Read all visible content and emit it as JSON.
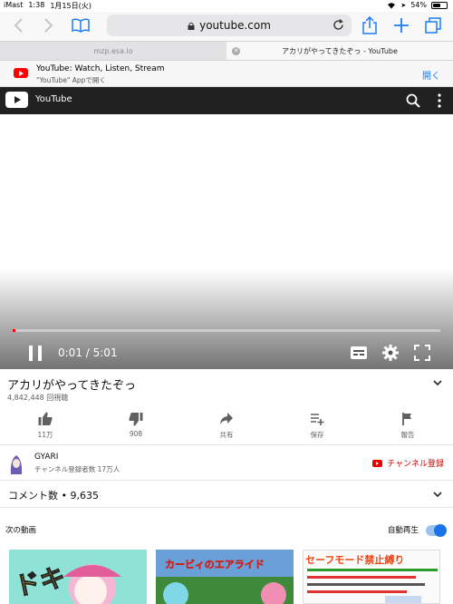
{
  "status_bar": {
    "carrier": "iMast",
    "time": "1:38",
    "date": "1月15日(火)",
    "battery": "54%",
    "battery_level": 0.54
  },
  "safari": {
    "url": "youtube.com",
    "tabs": [
      {
        "label": "mzp.esa.io",
        "active": false
      },
      {
        "label": "アカリがやってきたぞっ - YouTube",
        "active": true
      }
    ],
    "icons": [
      "back-icon",
      "forward-icon",
      "bookmarks-icon",
      "lock-icon",
      "reload-icon",
      "share-icon",
      "new-tab-icon",
      "tabs-icon"
    ]
  },
  "app_banner": {
    "title": "YouTube: Watch, Listen, Stream",
    "subtitle": "\"YouTube\" Appで開く",
    "open_label": "開く"
  },
  "yt_header": {
    "title": "YouTube"
  },
  "player": {
    "current_time": "0:01",
    "separator": " / ",
    "duration": "5:01",
    "progress": 0.003
  },
  "video": {
    "title": "アカリがやってきたぞっ",
    "views": "4,842,448 回視聴",
    "actions": [
      {
        "name": "like",
        "label": "11万",
        "icon": "thumbs-up-icon"
      },
      {
        "name": "dislike",
        "label": "908",
        "icon": "thumbs-down-icon"
      },
      {
        "name": "share",
        "label": "共有",
        "icon": "share-arrow-icon"
      },
      {
        "name": "save",
        "label": "保存",
        "icon": "playlist-add-icon"
      },
      {
        "name": "report",
        "label": "報告",
        "icon": "flag-icon"
      }
    ]
  },
  "channel": {
    "name": "GYARI",
    "subscribers": "チャンネル登録者数 17万人",
    "subscribe_label": "チャンネル登録"
  },
  "comments": {
    "label": "コメント数 • 9,635"
  },
  "up_next": {
    "label": "次の動画",
    "autoplay_label": "自動再生",
    "autoplay_on": true,
    "thumbnails": [
      {
        "text": "ドキ"
      },
      {
        "text": "カービィのエアライド"
      },
      {
        "text": "セーフモード禁止縛り"
      }
    ]
  },
  "colors": {
    "accent_blue": "#1a7cf5",
    "youtube_red": "#ff0000",
    "header_dark": "#212121"
  }
}
